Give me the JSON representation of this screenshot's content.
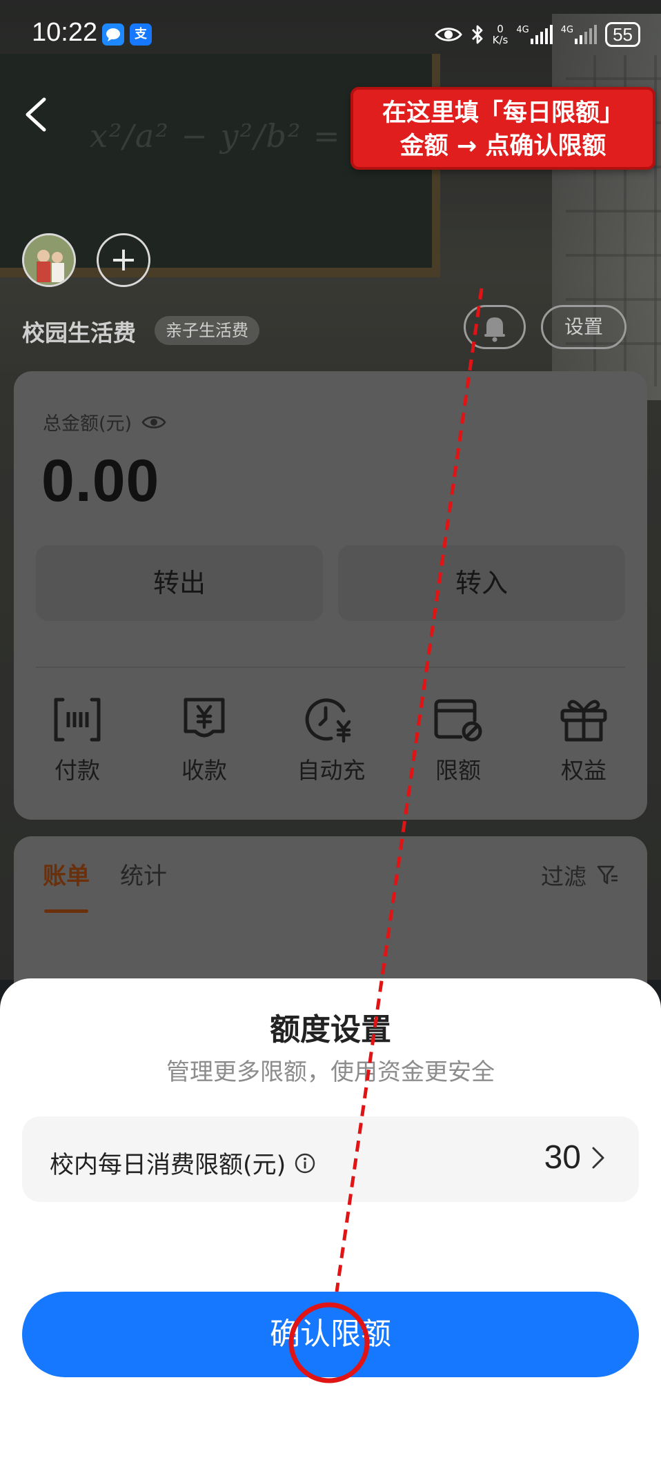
{
  "status_bar": {
    "time": "10:22",
    "app_icons": [
      "message-app-icon",
      "alipay-icon"
    ],
    "alipay_glyph": "支",
    "net_speed_top": "0",
    "net_speed_bottom": "K/s",
    "network_1": "4G",
    "network_2": "4G",
    "battery": "55"
  },
  "annotation": {
    "callout_line1": "在这里填「每日限额」",
    "callout_line2": "金额 → 点确认限额",
    "color": "#e11e1e"
  },
  "header": {
    "account_name": "校园生活费",
    "account_tag": "亲子生活费",
    "settings_label": "设置"
  },
  "balance": {
    "label": "总金额(元)",
    "amount": "0.00",
    "transfer_out": "转出",
    "transfer_in": "转入"
  },
  "quick_actions": [
    {
      "label": "付款",
      "icon": "payment-code-icon"
    },
    {
      "label": "收款",
      "icon": "receive-money-icon"
    },
    {
      "label": "自动充",
      "icon": "auto-recharge-icon"
    },
    {
      "label": "限额",
      "icon": "limit-card-icon"
    },
    {
      "label": "权益",
      "icon": "gift-icon"
    }
  ],
  "bills": {
    "tab_bill": "账单",
    "tab_stats": "统计",
    "filter": "过滤"
  },
  "sheet": {
    "title": "额度设置",
    "subtitle": "管理更多限额，使用资金更安全",
    "limit_label": "校内每日消费限额(元)",
    "limit_value": "30",
    "confirm": "确认限额"
  },
  "colors": {
    "accent_orange": "#a24a12",
    "primary_blue": "#1677ff",
    "annotation_red": "#e11e1e"
  }
}
